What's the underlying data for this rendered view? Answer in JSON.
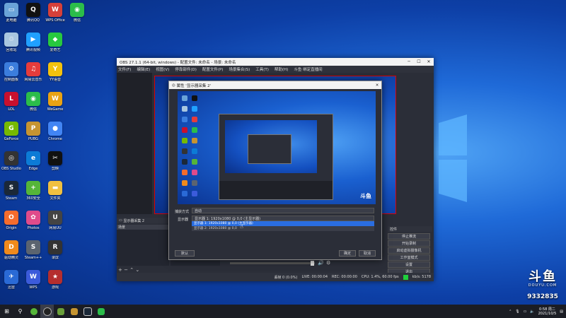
{
  "desktop": {
    "icons": [
      {
        "label": "此电脑",
        "color": "#6aa3d8",
        "glyph": "▭",
        "col": 0,
        "row": 0
      },
      {
        "label": "腾讯QQ",
        "color": "#111111",
        "glyph": "Q",
        "col": 1,
        "row": 0
      },
      {
        "label": "WPS Office",
        "color": "#d6403a",
        "glyph": "W",
        "col": 2,
        "row": 0
      },
      {
        "label": "微信",
        "color": "#2bbd4a",
        "glyph": "◉",
        "col": 3,
        "row": 0
      },
      {
        "label": "回收站",
        "color": "#a8c6e0",
        "glyph": "♲",
        "col": 0,
        "row": 1
      },
      {
        "label": "腾讯视频",
        "color": "#20a0ff",
        "glyph": "▶",
        "col": 1,
        "row": 1
      },
      {
        "label": "爱奇艺",
        "color": "#27c93f",
        "glyph": "◆",
        "col": 2,
        "row": 1
      },
      {
        "label": "控制面板",
        "color": "#3b7ddd",
        "glyph": "⚙",
        "col": 0,
        "row": 2
      },
      {
        "label": "网易云音乐",
        "color": "#e63c3c",
        "glyph": "♫",
        "col": 1,
        "row": 2
      },
      {
        "label": "YY语音",
        "color": "#f4c20d",
        "glyph": "Y",
        "col": 2,
        "row": 2
      },
      {
        "label": "LOL",
        "color": "#c8102e",
        "glyph": "L",
        "col": 0,
        "row": 3
      },
      {
        "label": "微信",
        "color": "#2bbd4a",
        "glyph": "◉",
        "col": 1,
        "row": 3
      },
      {
        "label": "WeGame",
        "color": "#e9a313",
        "glyph": "W",
        "col": 2,
        "row": 3
      },
      {
        "label": "GeForce",
        "color": "#76b900",
        "glyph": "G",
        "col": 0,
        "row": 4
      },
      {
        "label": "PUBG",
        "color": "#c59431",
        "glyph": "P",
        "col": 1,
        "row": 4
      },
      {
        "label": "Chrome",
        "color": "#4285f4",
        "glyph": "●",
        "col": 2,
        "row": 4
      },
      {
        "label": "OBS Studio",
        "color": "#333333",
        "glyph": "◎",
        "col": 0,
        "row": 5
      },
      {
        "label": "Edge",
        "color": "#0c7bd6",
        "glyph": "e",
        "col": 1,
        "row": 5
      },
      {
        "label": "剪映",
        "color": "#111111",
        "glyph": "✂",
        "col": 2,
        "row": 5
      },
      {
        "label": "Steam",
        "color": "#1b2838",
        "glyph": "S",
        "col": 0,
        "row": 6
      },
      {
        "label": "360安全",
        "color": "#55b539",
        "glyph": "+",
        "col": 1,
        "row": 6
      },
      {
        "label": "文件夹",
        "color": "#f0c040",
        "glyph": "▬",
        "col": 2,
        "row": 6
      },
      {
        "label": "Origin",
        "color": "#f56c2d",
        "glyph": "O",
        "col": 0,
        "row": 7
      },
      {
        "label": "Photos",
        "color": "#e04b8b",
        "glyph": "✿",
        "col": 1,
        "row": 7
      },
      {
        "label": "网易UU",
        "color": "#444444",
        "glyph": "U",
        "col": 2,
        "row": 7
      },
      {
        "label": "驱动精灵",
        "color": "#f08a1c",
        "glyph": "D",
        "col": 0,
        "row": 8
      },
      {
        "label": "Steam++",
        "color": "#5b6470",
        "glyph": "S",
        "col": 1,
        "row": 8
      },
      {
        "label": "录屏",
        "color": "#333333",
        "glyph": "R",
        "col": 2,
        "row": 8
      },
      {
        "label": "迅雷",
        "color": "#2a6ad6",
        "glyph": "✈",
        "col": 0,
        "row": 9
      },
      {
        "label": "WPS",
        "color": "#3b5bdb",
        "glyph": "W",
        "col": 1,
        "row": 9
      },
      {
        "label": "游戏",
        "color": "#b52e2e",
        "glyph": "★",
        "col": 2,
        "row": 9
      }
    ]
  },
  "obs": {
    "title": "OBS 27.1.1 (64-bit, windows) - 配置文件: 未命名 - 场景: 未命名",
    "menu": [
      "文件(F)",
      "编辑(E)",
      "视图(V)",
      "停靠部件(D)",
      "配置文件(P)",
      "场景集合(S)",
      "工具(T)",
      "帮助(H)",
      "斗鱼 绑定直播间"
    ],
    "dock_scene_header": "显示器采集 2",
    "dock_scene_label": "场景",
    "dock_sources_header": "来源",
    "controls_header": "控件",
    "controls": [
      "停止推流",
      "开始录制",
      "启动虚拟摄像机",
      "工作室模式",
      "设置",
      "退出"
    ],
    "status": {
      "dropped": "丢帧 0 (0.0%)",
      "live": "LIVE: 00:00:04",
      "rec": "REC: 00:00:00",
      "cpu": "CPU: 1.4%, 60.00 fps",
      "kbps": "kb/s: 5178"
    }
  },
  "dialog": {
    "title": "属性 '显示器采集 2'",
    "capture_method_label": "捕获方式",
    "capture_method_value": "自动",
    "display_label": "显示器",
    "display_value": "显示器 1: 1920x1080 @ 0,0 (主显示器)",
    "options": [
      "显示器 1: 1920x1080 @ 0,0 (主显示器)",
      "显示器 2: 1920x1080 @ 0,0"
    ],
    "defaults_button": "默认",
    "ok_button": "确定",
    "cancel_button": "取消"
  },
  "watermark": {
    "logo": "斗鱼",
    "brand": "DOUYU.COM",
    "room": "9332835"
  },
  "taskbar": {
    "time": "0:58 周二",
    "date": "2021/10/5"
  }
}
